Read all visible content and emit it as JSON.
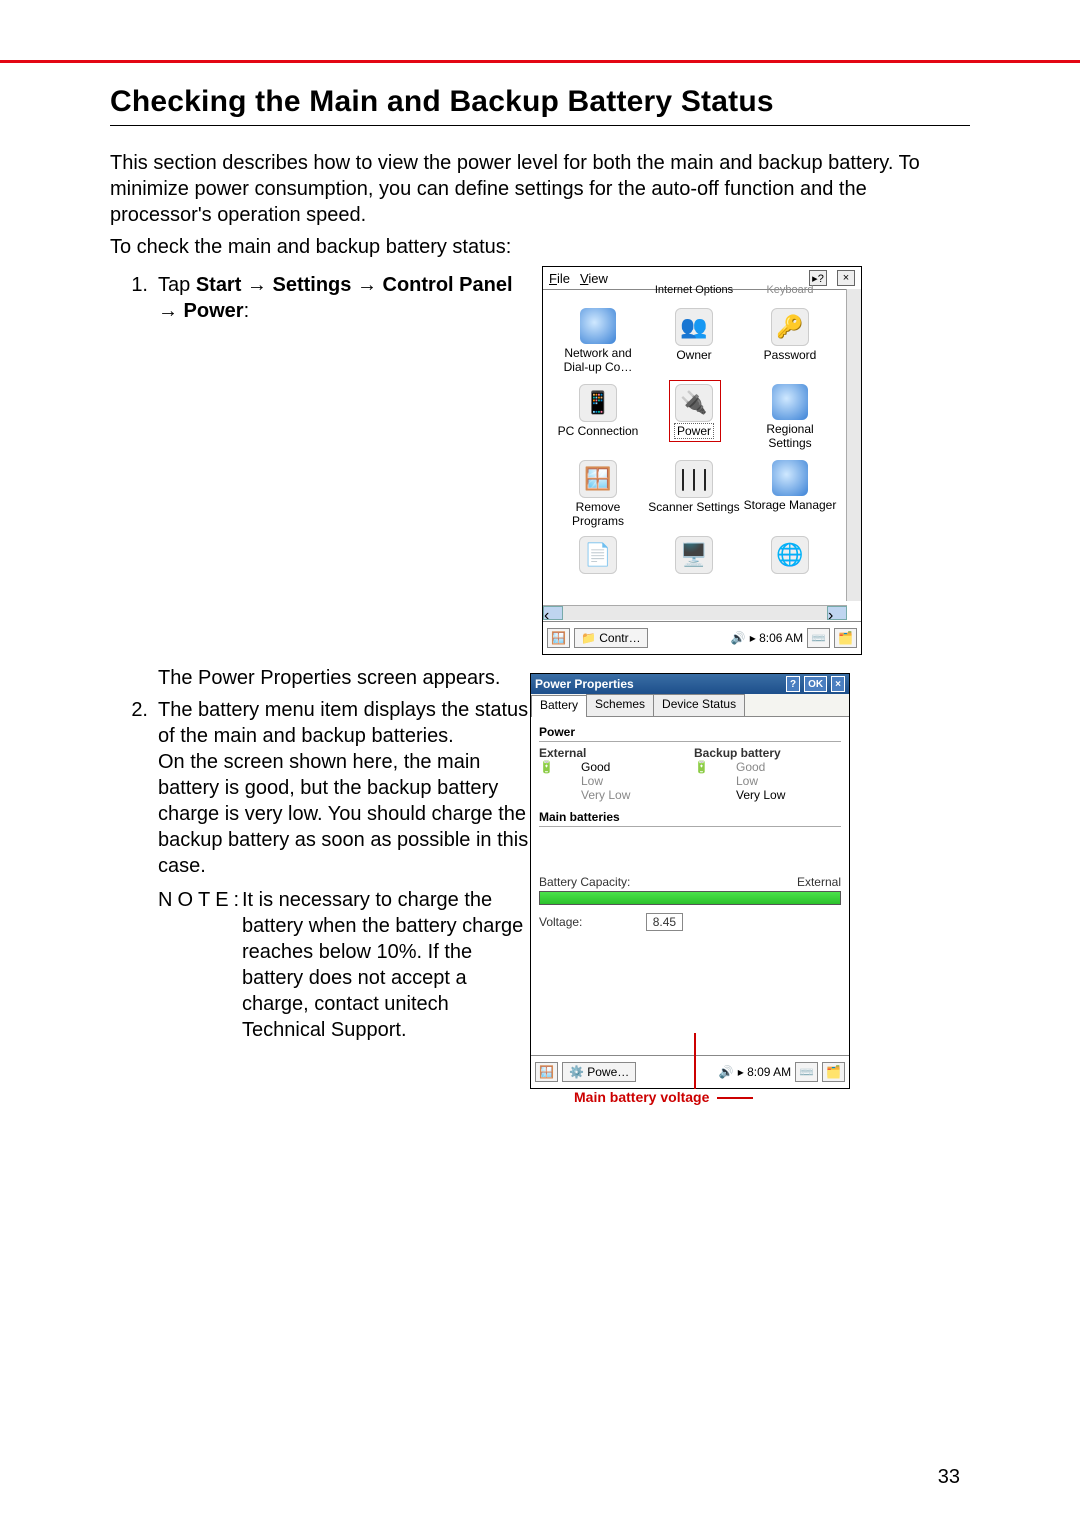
{
  "page_number": "33",
  "heading": "Checking the Main and Backup Battery Status",
  "intro": "This section describes how to view the power level for both the main and backup battery. To minimize power consumption, you can define settings for the auto-off function and the processor's operation speed.",
  "intro2": "To check the main and backup battery status:",
  "step1_prefix": "Tap ",
  "step1_path": "Start → Settings → Control Panel → Power",
  "step1_suffix": ":",
  "step1_after": "The Power Properties screen appears.",
  "step2a": "The battery menu item displays the status of the main and backup batteries.",
  "step2b": "On the screen shown here, the main battery is good, but the backup battery charge is very low. You should charge the backup battery as soon as possible in this case.",
  "note_label": "NOTE:",
  "note_text": "It is necessary to charge the battery when the battery charge reaches below 10%. If the battery does not accept a charge, contact unitech Technical Support.",
  "shot1": {
    "menu_file": "File",
    "menu_view": "View",
    "help": "?",
    "close": "×",
    "items": [
      {
        "label": "Internet Options"
      },
      {
        "label": "Keyboard"
      },
      {
        "label": "Network and Dial-up Co…"
      },
      {
        "label": "Owner"
      },
      {
        "label": "Password"
      },
      {
        "label": "PC Connection"
      },
      {
        "label": "Power"
      },
      {
        "label": "Regional Settings"
      },
      {
        "label": "Remove Programs"
      },
      {
        "label": "Scanner Settings"
      },
      {
        "label": "Storage Manager"
      }
    ],
    "task_app": "Contr…",
    "task_time": "8:06 AM"
  },
  "shot2": {
    "title": "Power Properties",
    "btn_help": "?",
    "btn_ok": "OK",
    "btn_close": "×",
    "tabs": [
      "Battery",
      "Schemes",
      "Device Status"
    ],
    "grp_power": "Power",
    "external": "External",
    "backup": "Backup battery",
    "levels": [
      "Good",
      "Low",
      "Very Low"
    ],
    "grp_main": "Main batteries",
    "cap_label": "Battery Capacity:",
    "cap_value": "External",
    "volt_label": "Voltage:",
    "volt_value": "8.45",
    "task_app": "Powe…",
    "task_time": "8:09 AM",
    "callout": "Main battery voltage"
  }
}
